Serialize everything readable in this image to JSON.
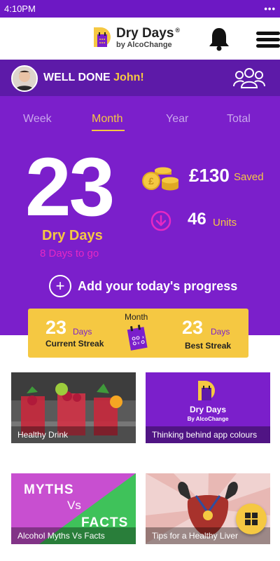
{
  "status_bar": {
    "time": "4:10PM",
    "menu_dots": "•••"
  },
  "app": {
    "name": "Dry Days",
    "registered": "®",
    "byline": "by AlcoChange"
  },
  "greeting": {
    "prefix": "WELL DONE ",
    "name": "John!"
  },
  "tabs": [
    {
      "label": "Week",
      "active": false
    },
    {
      "label": "Month",
      "active": true
    },
    {
      "label": "Year",
      "active": false
    },
    {
      "label": "Total",
      "active": false
    }
  ],
  "stats": {
    "dry_days_count": "23",
    "dry_days_label": "Dry Days",
    "days_to_go": "8 Days to go",
    "saved_amount": "£130",
    "saved_label": "Saved",
    "units_value": "46",
    "units_label": "Units"
  },
  "add_progress": {
    "label": "Add your today's progress"
  },
  "streak": {
    "period": "Month",
    "current_value": "23",
    "current_unit": "Days",
    "current_label": "Current Streak",
    "best_value": "23",
    "best_unit": "Days",
    "best_label": "Best Streak"
  },
  "tiles": [
    {
      "caption": "Healthy Drink"
    },
    {
      "caption": "Thinking behind app colours",
      "logo_title": "Dry Days",
      "logo_sub": "By AlcoChange"
    },
    {
      "caption": "Alcohol Myths Vs Facts",
      "text_1": "MYTHS",
      "text_2": "Vs",
      "text_3": "FACTS"
    },
    {
      "caption": "Tips for a Healthy Liver"
    }
  ],
  "colors": {
    "primary_purple": "#7b1fcb",
    "header_purple": "#6d18c4",
    "greeting_purple": "#5d1aa8",
    "accent_yellow": "#f5c842",
    "accent_pink": "#e628c4"
  },
  "icons": [
    "bell-icon",
    "hamburger-menu-icon",
    "friends-icon",
    "coins-icon",
    "down-arrow-circle-icon",
    "plus-circle-icon",
    "calendar-icon",
    "grid-icon"
  ]
}
